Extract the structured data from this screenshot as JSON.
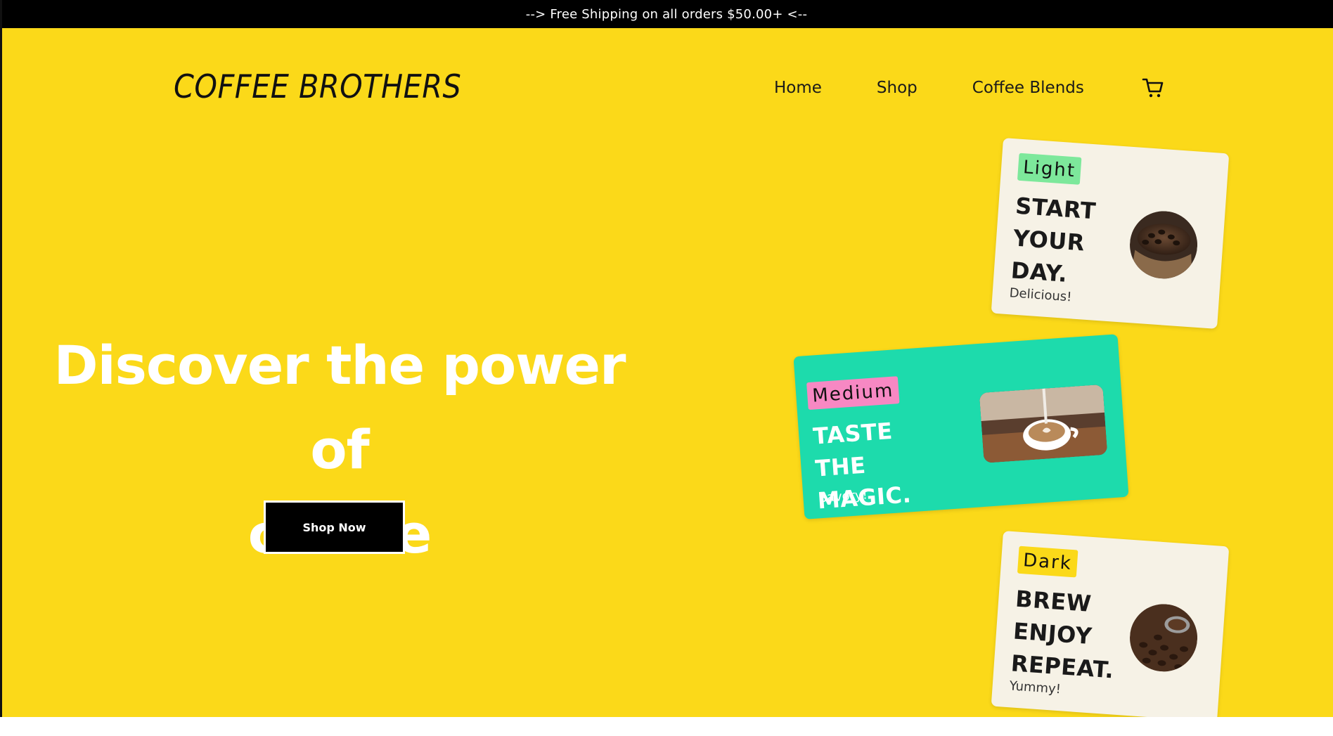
{
  "promo": {
    "text": "--> Free Shipping on all orders $50.00+ <--"
  },
  "header": {
    "brand": "COFFEE BROTHERS",
    "nav": [
      {
        "label": "Home"
      },
      {
        "label": "Shop"
      },
      {
        "label": "Coffee Blends"
      }
    ],
    "cart_icon": "cart-icon"
  },
  "hero": {
    "headline_line1": "Discover the power of",
    "headline_line2": "coffee",
    "cta_label": "Shop Now"
  },
  "cards": [
    {
      "tag": "Light",
      "title_lines": [
        "START",
        "YOUR",
        "DAY."
      ],
      "subtitle": "Delicious!",
      "image": "coffee-beans-sack-image",
      "tag_color": "#7de89b",
      "bg_color": "#f6f2e6"
    },
    {
      "tag": "Medium",
      "title_lines": [
        "TASTE",
        "THE",
        "MAGIC."
      ],
      "subtitle": "Savory!",
      "image": "latte-art-cup-image",
      "tag_color": "#f788c3",
      "bg_color": "#1ddbac"
    },
    {
      "tag": "Dark",
      "title_lines": [
        "BREW",
        "ENJOY",
        "REPEAT."
      ],
      "subtitle": "Yummy!",
      "image": "coffee-beans-scoop-image",
      "tag_color": "#fbd919",
      "bg_color": "#f6f2e6"
    }
  ],
  "colors": {
    "hero_bg": "#fbd919",
    "promo_bg": "#000000",
    "cta_bg": "#000000",
    "headline_text": "#ffffff"
  }
}
